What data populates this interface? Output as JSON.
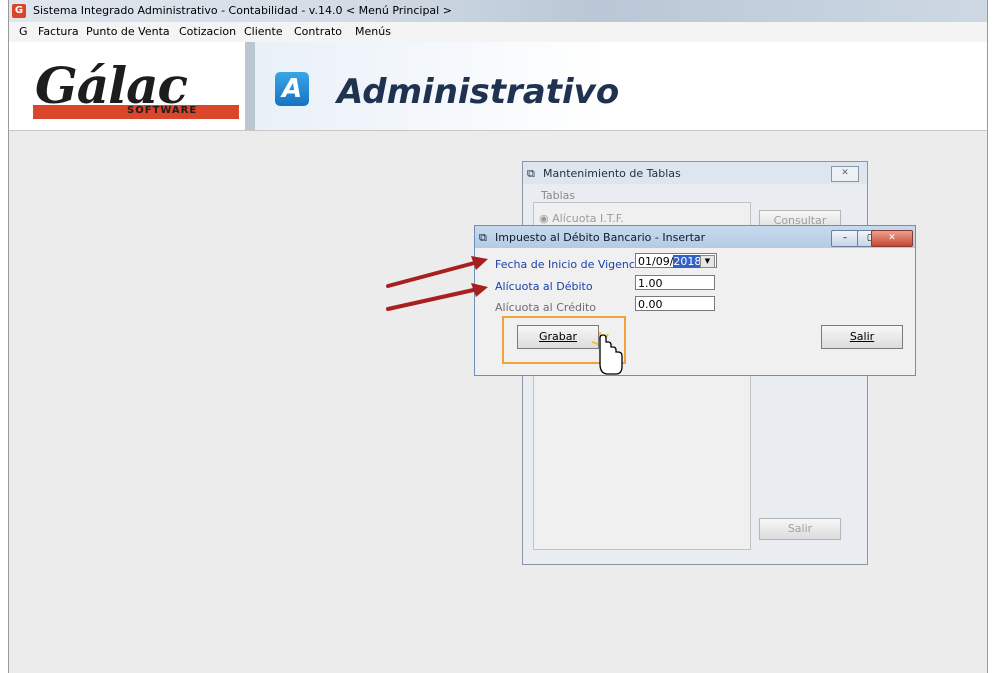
{
  "app": {
    "title": "Sistema Integrado Administrativo - Contabilidad - v.14.0 < Menú Principal >",
    "icon_letter": "G"
  },
  "menu": [
    "G",
    "Factura",
    "Punto de Venta",
    "Cotizacion",
    "Cliente",
    "Contrato",
    "Menús"
  ],
  "banner": {
    "logo_text": "Gálac",
    "logo_sub": "SOFTWARE",
    "a_letter": "A",
    "product": "Administrativo"
  },
  "mantenimiento": {
    "title": "Mantenimiento de Tablas",
    "group_label": "Tablas",
    "radio_label": "Alícuota I.T.F.",
    "consultar_label": "Consultar",
    "salir_label": "Salir",
    "close_glyph": "✕"
  },
  "dialog": {
    "title": "Impuesto al Débito Bancario - Insertar",
    "fields": {
      "fecha_label": "Fecha de Inicio de Vigencia",
      "fecha_value_prefix": "01/09/",
      "fecha_value_selected": "2018",
      "alicuota_debito_label": "Alícuota al Débito",
      "alicuota_debito_value": "1.00",
      "alicuota_credito_label": "Alícuota al Crédito",
      "alicuota_credito_value": "0.00"
    },
    "grabar_label": "Grabar",
    "salir_label": "Salir",
    "minimize_glyph": "–",
    "maximize_glyph": "▢",
    "close_glyph": "✕",
    "dropdown_glyph": "▼"
  },
  "colors": {
    "highlight": "#f2a23a",
    "arrow": "#a81f1f",
    "label_blue": "#1d3fa8"
  }
}
